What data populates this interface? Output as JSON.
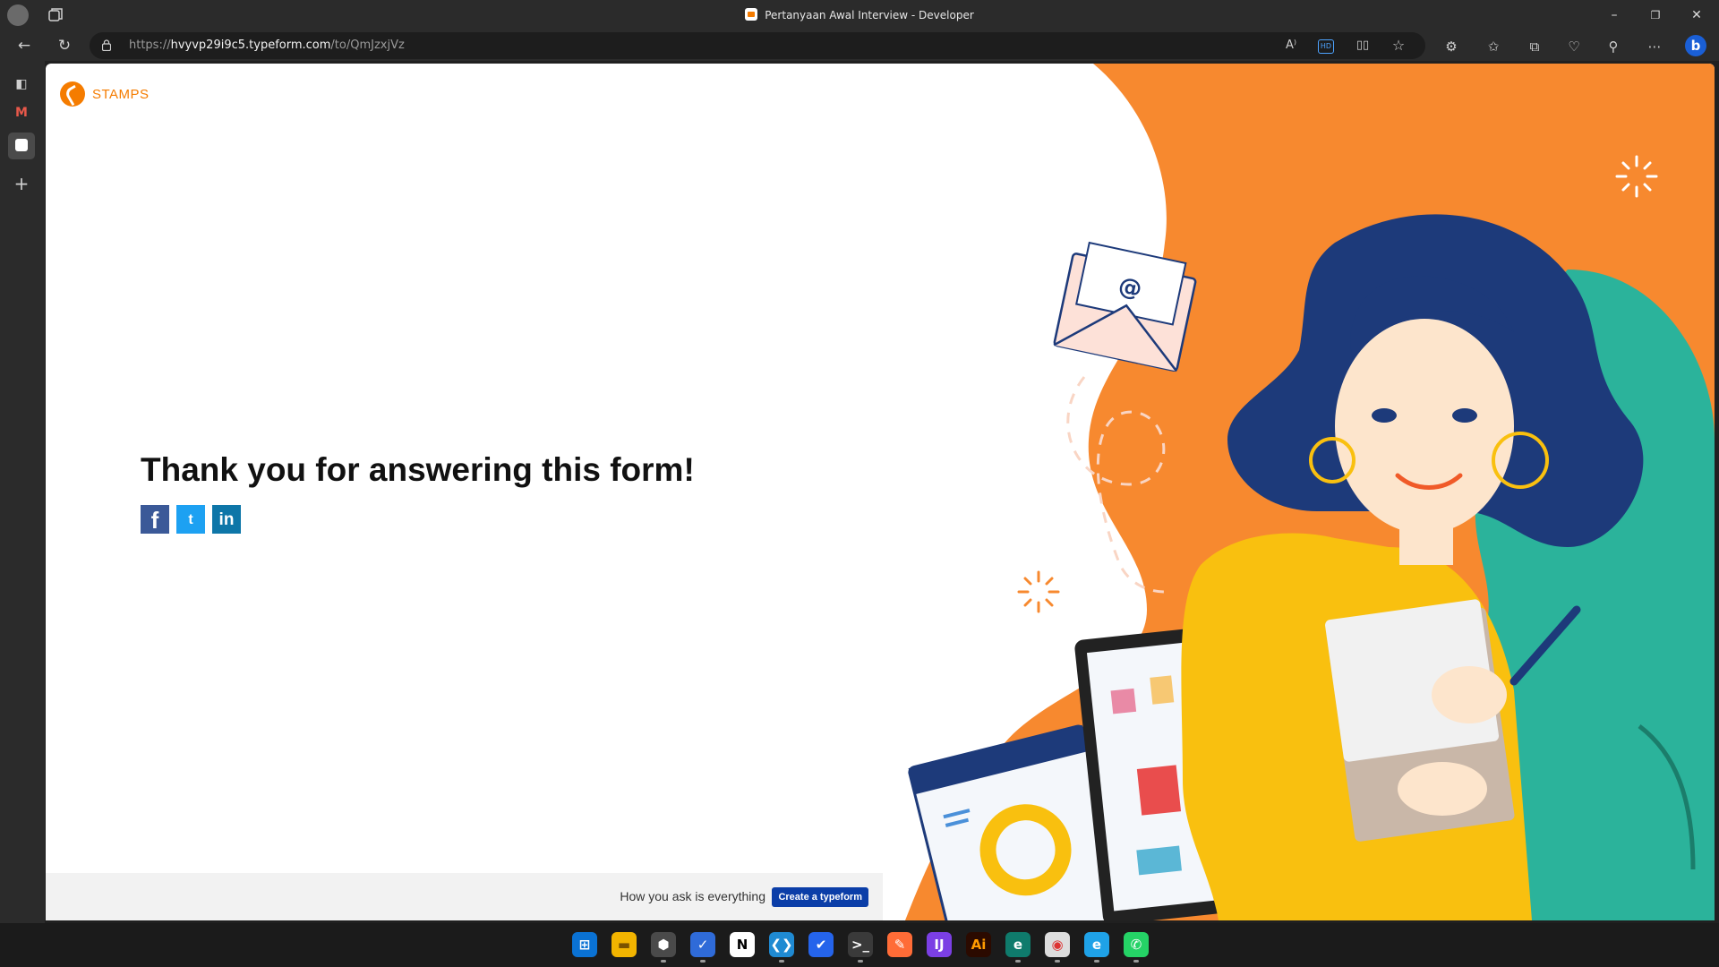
{
  "window": {
    "title": "Pertanyaan Awal Interview - Developer",
    "minimize_glyph": "–",
    "restore_glyph": "❐",
    "close_glyph": "✕"
  },
  "address_bar": {
    "scheme": "https://",
    "host": "hvyvp29i9c5.typeform.com",
    "path": "/to/QmJzxjVz"
  },
  "page": {
    "brand_name": "STAMPS",
    "thank_you_heading": "Thank you for answering this form!",
    "share": {
      "facebook_glyph": "f",
      "twitter_glyph": "t",
      "linkedin_glyph": "in"
    },
    "footer": {
      "tagline": "How you ask is everything",
      "create_button": "Create a typeform"
    }
  },
  "colors": {
    "brand_orange": "#f57c00",
    "illustration_orange": "#f7892f",
    "teal": "#2bb39b",
    "hair_navy": "#1d3a7a",
    "shirt_yellow": "#f9c00f",
    "footer_button": "#0b3ea8"
  },
  "taskbar": {
    "apps": [
      {
        "name": "start-icon",
        "glyph": "⊞"
      },
      {
        "name": "file-explorer-icon",
        "glyph": "▬"
      },
      {
        "name": "cube-app-icon",
        "glyph": "⬢"
      },
      {
        "name": "tasks-check-icon",
        "glyph": "✓"
      },
      {
        "name": "notion-icon",
        "glyph": "N"
      },
      {
        "name": "vscode-icon",
        "glyph": "❮❯"
      },
      {
        "name": "todo-icon",
        "glyph": "✔"
      },
      {
        "name": "terminal-icon",
        "glyph": ">_"
      },
      {
        "name": "postman-icon",
        "glyph": "✎"
      },
      {
        "name": "jetbrains-icon",
        "glyph": "IJ"
      },
      {
        "name": "illustrator-icon",
        "glyph": "Ai"
      },
      {
        "name": "edge-dev-icon",
        "glyph": "e"
      },
      {
        "name": "chrome-icon",
        "glyph": "◉"
      },
      {
        "name": "edge-icon",
        "glyph": "e"
      },
      {
        "name": "whatsapp-icon",
        "glyph": "✆"
      }
    ]
  }
}
